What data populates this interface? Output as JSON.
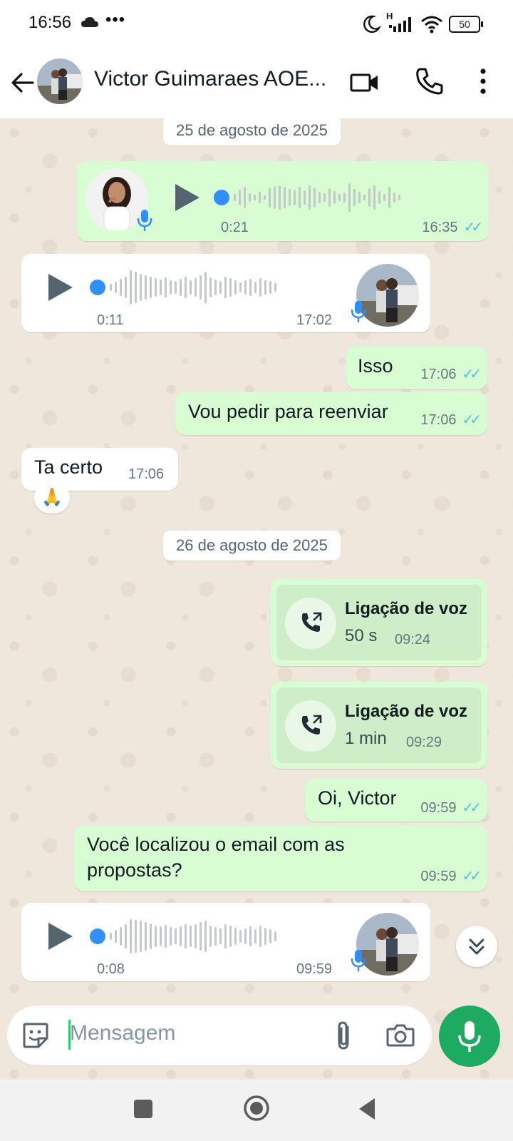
{
  "status_bar": {
    "time": "16:56",
    "dots": "•••",
    "battery": "50",
    "network": "H"
  },
  "header": {
    "contact_name": "Victor Guimaraes AOE..."
  },
  "chat": {
    "date1": "25 de agosto de 2025",
    "date2": "26 de agosto de 2025",
    "voice1": {
      "duration": "0:21",
      "time": "16:35"
    },
    "voice2": {
      "duration": "0:11",
      "time": "17:02"
    },
    "msg_isso": {
      "text": "Isso",
      "time": "17:06"
    },
    "msg_reenviar": {
      "text": "Vou pedir para reenviar",
      "time": "17:06"
    },
    "msg_tacerto": {
      "text": "Ta certo",
      "time": "17:06",
      "reaction": "🙏"
    },
    "call1": {
      "title": "Ligação de voz",
      "duration": "50 s",
      "time": "09:24"
    },
    "call2": {
      "title": "Ligação de voz",
      "duration": "1 min",
      "time": "09:29"
    },
    "msg_oi": {
      "text": "Oi, Victor",
      "time": "09:59"
    },
    "msg_email": {
      "line1": "Você localizou o email com as",
      "line2": "propostas?",
      "time": "09:59"
    },
    "voice3": {
      "duration": "0:08",
      "time": "09:59"
    }
  },
  "input": {
    "placeholder": "Mensagem"
  },
  "icons": {
    "back": "arrow-left-icon",
    "video": "video-call-icon",
    "call": "phone-icon",
    "menu": "more-vert-icon",
    "sticker": "sticker-icon",
    "attach": "paperclip-icon",
    "camera": "camera-icon",
    "mic": "microphone-icon",
    "scroll": "chevron-double-down-icon"
  },
  "colors": {
    "outgoing": "#d9fdd3",
    "incoming": "#ffffff",
    "tick": "#53bdeb",
    "accent": "#1daa61",
    "progress_dot": "#2f8fff"
  }
}
